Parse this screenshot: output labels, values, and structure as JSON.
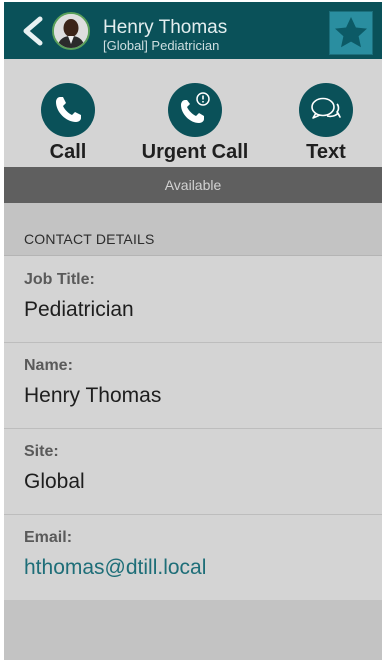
{
  "header": {
    "name": "Henry Thomas",
    "subtitle": "[Global] Pediatrician",
    "colors": {
      "bar": "#0a5159",
      "favorite": "#2a8ea0"
    }
  },
  "icons": {
    "back": "chevron-left-icon",
    "avatar": "profile-photo",
    "favorite": "star-icon",
    "call": "phone-icon",
    "urgent": "phone-alert-icon",
    "text": "chat-bubbles-icon"
  },
  "actions": {
    "call_label": "Call",
    "urgent_label": "Urgent Call",
    "text_label": "Text"
  },
  "status": {
    "text": "Available"
  },
  "details": {
    "section_title": "CONTACT DETAILS",
    "fields": [
      {
        "label": "Job Title:",
        "value": "Pediatrician"
      },
      {
        "label": "Name:",
        "value": "Henry Thomas"
      },
      {
        "label": "Site:",
        "value": "Global"
      },
      {
        "label": "Email:",
        "value": "hthomas@dtill.local"
      }
    ]
  }
}
